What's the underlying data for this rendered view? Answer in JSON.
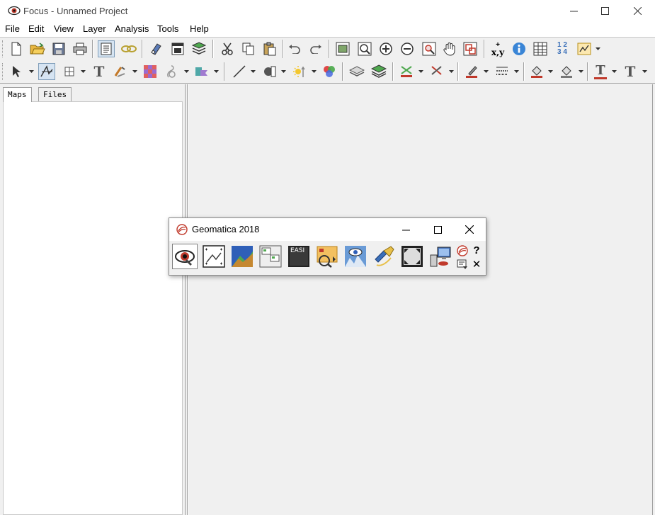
{
  "window": {
    "title": "Focus - Unnamed Project",
    "icon": "eye-icon"
  },
  "menu": [
    "File",
    "Edit",
    "View",
    "Layer",
    "Analysis",
    "Tools",
    "Help"
  ],
  "toolbar": {
    "row1": [
      "new-file-icon",
      "open-folder-icon",
      "save-icon",
      "print-icon",
      "properties-list-icon",
      "link-icon",
      "eraser-icon",
      "window-icon",
      "layers-stack-icon",
      "cut-icon",
      "copy-icon",
      "paste-icon",
      "undo-icon",
      "redo-icon",
      "zoom-extents-icon",
      "zoom-box-icon",
      "zoom-in-icon",
      "zoom-out-icon",
      "zoom-selection-icon",
      "pan-hand-icon",
      "overview-icon",
      "coordinate-icon",
      "info-icon",
      "table-icon",
      "numbering-icon",
      "chart-icon"
    ],
    "coordinate_label_top": "+",
    "coordinate_label": "x,y",
    "numbering_label_top": "1 2",
    "numbering_label_bottom": "3 4",
    "text_tool_label": "T"
  },
  "left_panel": {
    "tabs": [
      "Maps",
      "Files"
    ],
    "active_tab": "Maps"
  },
  "launcher": {
    "title": "Geomatica 2018",
    "icon": "geomatica-logo-icon",
    "easi_label": "EASI",
    "help_label": "?",
    "close_label": "✕",
    "buttons": [
      "focus-eye-icon",
      "ortho-engine-icon",
      "modeler-icon",
      "chip-manager-icon",
      "easi-icon",
      "fly-icon",
      "orthophoto-icon",
      "satellite-icon",
      "full-screen-icon",
      "license-manager-icon"
    ]
  },
  "colors": {
    "accent_red": "#c0392b",
    "pressed_bg": "#d6e4f2",
    "frame": "#a0a0a0"
  }
}
